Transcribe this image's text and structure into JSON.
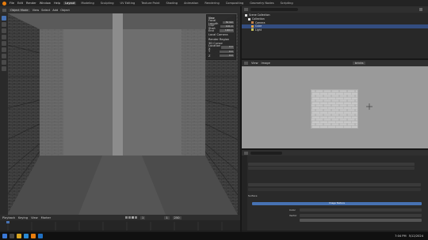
{
  "topbar": {
    "menus": [
      "File",
      "Edit",
      "Render",
      "Window",
      "Help"
    ],
    "workspaces": [
      "Layout",
      "Modeling",
      "Sculpting",
      "UV Editing",
      "Texture Paint",
      "Shading",
      "Animation",
      "Rendering",
      "Compositing",
      "Geometry Nodes",
      "Scripting"
    ],
    "active_workspace": "Layout"
  },
  "viewport": {
    "mode": "Object Mode",
    "menus": [
      "View",
      "Select",
      "Add",
      "Object"
    ]
  },
  "npanel": {
    "title": "View",
    "rows": [
      [
        "Focal Length",
        "50 mm"
      ],
      [
        "Clip Start",
        "0.01 m"
      ],
      [
        "End",
        "1000 m"
      ],
      [
        "Local Camera",
        ""
      ],
      [
        "Render Region",
        ""
      ],
      [
        "3D Cursor",
        ""
      ],
      [
        "Location X",
        "0 m"
      ],
      [
        "Y",
        "0 m"
      ],
      [
        "Z",
        "0 m"
      ]
    ]
  },
  "outliner": {
    "title": "Scene Collection",
    "rows": [
      "Scene Collection",
      "Collection",
      "Camera",
      "Cube",
      "Light"
    ]
  },
  "image_editor": {
    "title": "Image",
    "view": "View",
    "image_name": "bricks"
  },
  "properties": {
    "tabs": [
      "Tool",
      "Render",
      "Output",
      "View Layer",
      "Scene",
      "World",
      "Object",
      "Modifiers",
      "Material"
    ],
    "section": "Image Texture",
    "field_labels": [
      "Surface",
      "Color",
      "Vector"
    ]
  },
  "timeline": {
    "menus": [
      "Playback",
      "Keying",
      "View",
      "Marker"
    ],
    "current_frame": "1",
    "start": "1",
    "end": "250"
  },
  "taskbar": {
    "time": "7:04 PM",
    "date": "5/12/2024"
  },
  "colors": {
    "accent": "#4772b3",
    "selected_row": "#334d80",
    "panel": "#2b2b2b",
    "viewport_bg": "#3a3a3a"
  }
}
